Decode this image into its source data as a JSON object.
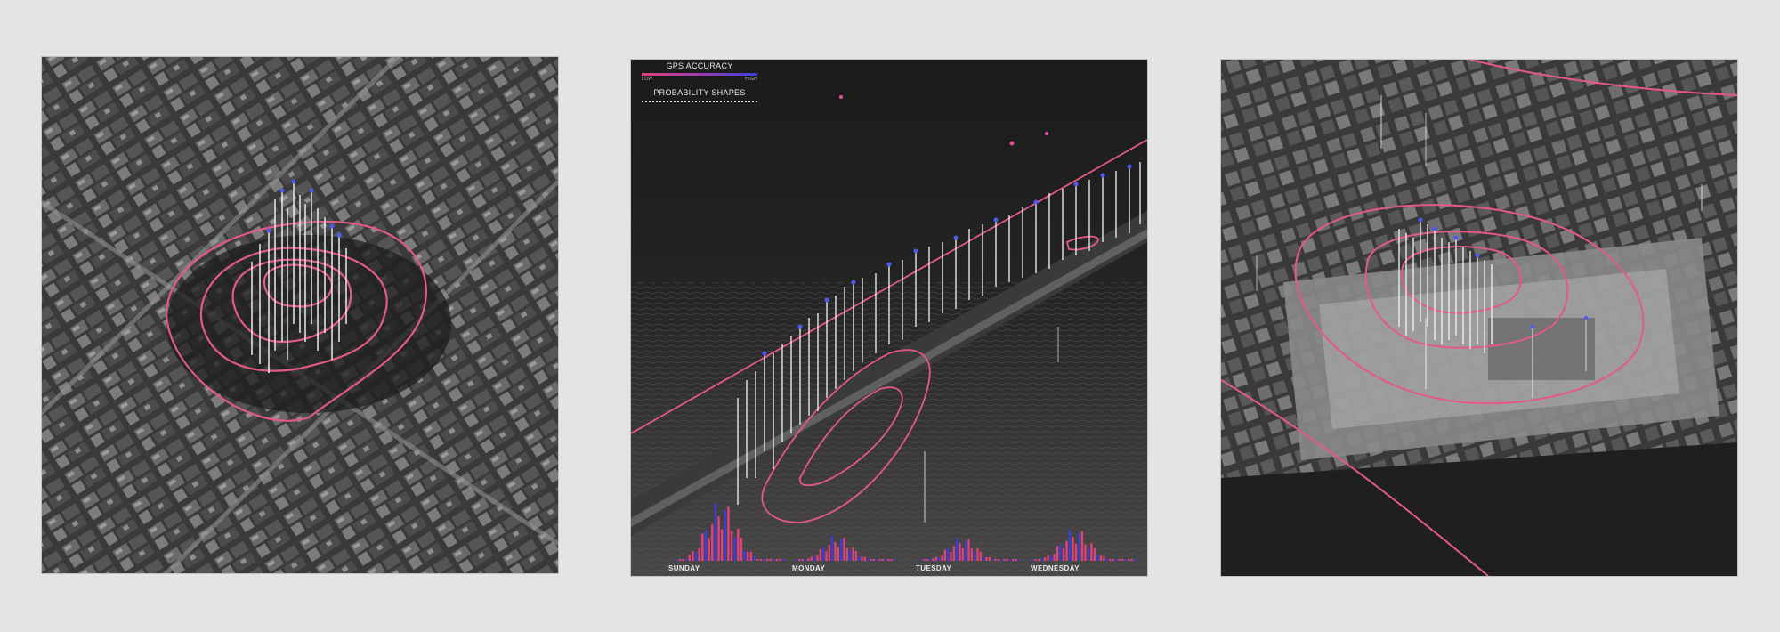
{
  "legend": {
    "gps_title": "GPS ACCURACY",
    "low_label": "LOW",
    "high_label": "HIGH",
    "shapes_title": "PROBABILITY SHAPES"
  },
  "days": [
    "SUNDAY",
    "MONDAY",
    "TUESDAY",
    "WEDNESDAY"
  ],
  "colors": {
    "page_bg": "#e4e4e2",
    "contour": "#e45a84",
    "stalk": "#f2f2f2",
    "point_blue": "#4c5cf0",
    "histogram_pink": "#e0427a",
    "histogram_blue": "#3b3fd8"
  }
}
